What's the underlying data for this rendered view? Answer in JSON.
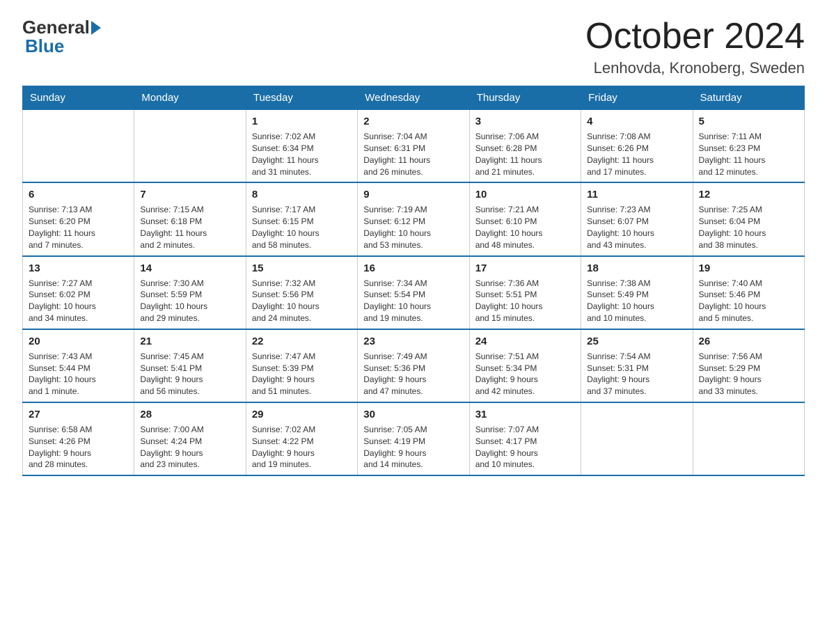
{
  "header": {
    "logo_general": "General",
    "logo_blue": "Blue",
    "month_title": "October 2024",
    "location": "Lenhovda, Kronoberg, Sweden"
  },
  "weekdays": [
    "Sunday",
    "Monday",
    "Tuesday",
    "Wednesday",
    "Thursday",
    "Friday",
    "Saturday"
  ],
  "weeks": [
    [
      {
        "day": "",
        "info": ""
      },
      {
        "day": "",
        "info": ""
      },
      {
        "day": "1",
        "info": "Sunrise: 7:02 AM\nSunset: 6:34 PM\nDaylight: 11 hours\nand 31 minutes."
      },
      {
        "day": "2",
        "info": "Sunrise: 7:04 AM\nSunset: 6:31 PM\nDaylight: 11 hours\nand 26 minutes."
      },
      {
        "day": "3",
        "info": "Sunrise: 7:06 AM\nSunset: 6:28 PM\nDaylight: 11 hours\nand 21 minutes."
      },
      {
        "day": "4",
        "info": "Sunrise: 7:08 AM\nSunset: 6:26 PM\nDaylight: 11 hours\nand 17 minutes."
      },
      {
        "day": "5",
        "info": "Sunrise: 7:11 AM\nSunset: 6:23 PM\nDaylight: 11 hours\nand 12 minutes."
      }
    ],
    [
      {
        "day": "6",
        "info": "Sunrise: 7:13 AM\nSunset: 6:20 PM\nDaylight: 11 hours\nand 7 minutes."
      },
      {
        "day": "7",
        "info": "Sunrise: 7:15 AM\nSunset: 6:18 PM\nDaylight: 11 hours\nand 2 minutes."
      },
      {
        "day": "8",
        "info": "Sunrise: 7:17 AM\nSunset: 6:15 PM\nDaylight: 10 hours\nand 58 minutes."
      },
      {
        "day": "9",
        "info": "Sunrise: 7:19 AM\nSunset: 6:12 PM\nDaylight: 10 hours\nand 53 minutes."
      },
      {
        "day": "10",
        "info": "Sunrise: 7:21 AM\nSunset: 6:10 PM\nDaylight: 10 hours\nand 48 minutes."
      },
      {
        "day": "11",
        "info": "Sunrise: 7:23 AM\nSunset: 6:07 PM\nDaylight: 10 hours\nand 43 minutes."
      },
      {
        "day": "12",
        "info": "Sunrise: 7:25 AM\nSunset: 6:04 PM\nDaylight: 10 hours\nand 38 minutes."
      }
    ],
    [
      {
        "day": "13",
        "info": "Sunrise: 7:27 AM\nSunset: 6:02 PM\nDaylight: 10 hours\nand 34 minutes."
      },
      {
        "day": "14",
        "info": "Sunrise: 7:30 AM\nSunset: 5:59 PM\nDaylight: 10 hours\nand 29 minutes."
      },
      {
        "day": "15",
        "info": "Sunrise: 7:32 AM\nSunset: 5:56 PM\nDaylight: 10 hours\nand 24 minutes."
      },
      {
        "day": "16",
        "info": "Sunrise: 7:34 AM\nSunset: 5:54 PM\nDaylight: 10 hours\nand 19 minutes."
      },
      {
        "day": "17",
        "info": "Sunrise: 7:36 AM\nSunset: 5:51 PM\nDaylight: 10 hours\nand 15 minutes."
      },
      {
        "day": "18",
        "info": "Sunrise: 7:38 AM\nSunset: 5:49 PM\nDaylight: 10 hours\nand 10 minutes."
      },
      {
        "day": "19",
        "info": "Sunrise: 7:40 AM\nSunset: 5:46 PM\nDaylight: 10 hours\nand 5 minutes."
      }
    ],
    [
      {
        "day": "20",
        "info": "Sunrise: 7:43 AM\nSunset: 5:44 PM\nDaylight: 10 hours\nand 1 minute."
      },
      {
        "day": "21",
        "info": "Sunrise: 7:45 AM\nSunset: 5:41 PM\nDaylight: 9 hours\nand 56 minutes."
      },
      {
        "day": "22",
        "info": "Sunrise: 7:47 AM\nSunset: 5:39 PM\nDaylight: 9 hours\nand 51 minutes."
      },
      {
        "day": "23",
        "info": "Sunrise: 7:49 AM\nSunset: 5:36 PM\nDaylight: 9 hours\nand 47 minutes."
      },
      {
        "day": "24",
        "info": "Sunrise: 7:51 AM\nSunset: 5:34 PM\nDaylight: 9 hours\nand 42 minutes."
      },
      {
        "day": "25",
        "info": "Sunrise: 7:54 AM\nSunset: 5:31 PM\nDaylight: 9 hours\nand 37 minutes."
      },
      {
        "day": "26",
        "info": "Sunrise: 7:56 AM\nSunset: 5:29 PM\nDaylight: 9 hours\nand 33 minutes."
      }
    ],
    [
      {
        "day": "27",
        "info": "Sunrise: 6:58 AM\nSunset: 4:26 PM\nDaylight: 9 hours\nand 28 minutes."
      },
      {
        "day": "28",
        "info": "Sunrise: 7:00 AM\nSunset: 4:24 PM\nDaylight: 9 hours\nand 23 minutes."
      },
      {
        "day": "29",
        "info": "Sunrise: 7:02 AM\nSunset: 4:22 PM\nDaylight: 9 hours\nand 19 minutes."
      },
      {
        "day": "30",
        "info": "Sunrise: 7:05 AM\nSunset: 4:19 PM\nDaylight: 9 hours\nand 14 minutes."
      },
      {
        "day": "31",
        "info": "Sunrise: 7:07 AM\nSunset: 4:17 PM\nDaylight: 9 hours\nand 10 minutes."
      },
      {
        "day": "",
        "info": ""
      },
      {
        "day": "",
        "info": ""
      }
    ]
  ]
}
